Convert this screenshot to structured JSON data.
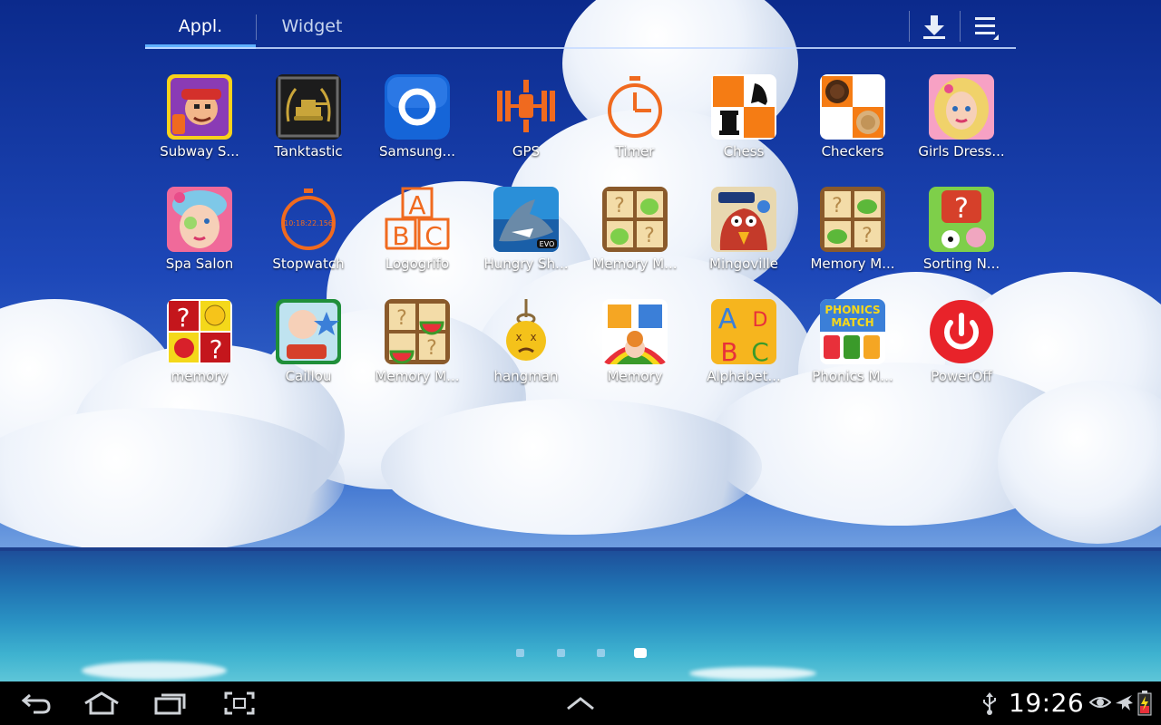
{
  "tabs": {
    "apps": "Appl.",
    "widget": "Widget"
  },
  "header_icons": [
    "download-icon",
    "menu-icon"
  ],
  "apps": [
    {
      "label": "Subway S...",
      "icon": "subway-surfers-icon",
      "color": "#8a3bb5"
    },
    {
      "label": "Tanktastic",
      "icon": "tanktastic-icon",
      "color": "#222222"
    },
    {
      "label": "Samsung...",
      "icon": "samsung-ring-icon",
      "color": "#1565d8"
    },
    {
      "label": "GPS",
      "icon": "satellite-icon",
      "color": "#f06a1f"
    },
    {
      "label": "Timer",
      "icon": "stopwatch-icon",
      "color": "#f06a1f"
    },
    {
      "label": "Chess",
      "icon": "chess-icon",
      "color": "#f57c14"
    },
    {
      "label": "Checkers",
      "icon": "checkers-icon",
      "color": "#f57c14"
    },
    {
      "label": "Girls Dress...",
      "icon": "girl-dressup-icon",
      "color": "#f7a1c4"
    },
    {
      "label": "Spa Salon",
      "icon": "spa-salon-icon",
      "color": "#e84d8a"
    },
    {
      "label": "Stopwatch",
      "icon": "stopwatch-icon",
      "color": "#f06a1f"
    },
    {
      "label": "Logogrifo",
      "icon": "abc-blocks-icon",
      "color": "#f06a1f"
    },
    {
      "label": "Hungry Sh...",
      "icon": "shark-icon",
      "color": "#2a8fd8"
    },
    {
      "label": "Memory M...",
      "icon": "memory-aliens-icon",
      "color": "#8a5a2b"
    },
    {
      "label": "Mingoville",
      "icon": "mingoville-icon",
      "color": "#c43a2a"
    },
    {
      "label": "Memory M...",
      "icon": "memory-frogs-icon",
      "color": "#8a5a2b"
    },
    {
      "label": "Sorting N...",
      "icon": "sorting-icon",
      "color": "#d6402a"
    },
    {
      "label": "memory",
      "icon": "memory-question-icon",
      "color": "#c4161c"
    },
    {
      "label": "Caillou",
      "icon": "caillou-icon",
      "color": "#1f8f3a"
    },
    {
      "label": "Memory M...",
      "icon": "memory-watermelon-icon",
      "color": "#8a5a2b"
    },
    {
      "label": "hangman",
      "icon": "hangman-icon",
      "color": "#f4c21a"
    },
    {
      "label": "Memory",
      "icon": "memory-kids-icon",
      "color": "#f5a623"
    },
    {
      "label": "Alphabet...",
      "icon": "alphabet-icon",
      "color": "#f6b51e"
    },
    {
      "label": "Phonics M...",
      "icon": "phonics-match-icon",
      "color": "#3b7fd8"
    },
    {
      "label": "PowerOff",
      "icon": "power-icon",
      "color": "#e8232a"
    }
  ],
  "page_indicator": {
    "pages": 4,
    "current": 4
  },
  "navbar": {
    "buttons": [
      "back-icon",
      "home-icon",
      "recent-apps-icon",
      "screenshot-icon",
      "up-arrow-icon"
    ],
    "status_icons": [
      "usb-icon",
      "eye-icon",
      "airplane-icon",
      "battery-icon"
    ],
    "clock": "19:26"
  }
}
